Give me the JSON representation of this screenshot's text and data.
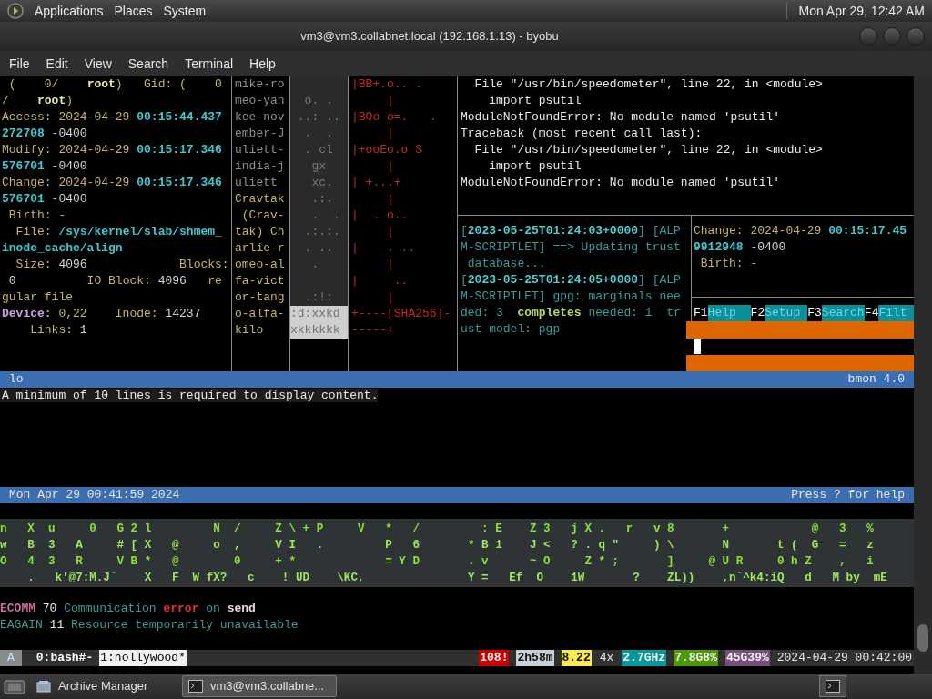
{
  "top_panel": {
    "menus": [
      "Applications",
      "Places",
      "System"
    ],
    "clock": "Mon Apr 29, 12:42 AM"
  },
  "window": {
    "title": "vm3@vm3.collabnet.local (192.168.1.13) - byobu"
  },
  "menu_bar": [
    "File",
    "Edit",
    "View",
    "Search",
    "Terminal",
    "Help"
  ],
  "stat_pane": {
    "lines": [
      [
        {
          "text": " (    0/    ",
          "kind": "label"
        },
        {
          "text": "root",
          "kind": "bold"
        },
        {
          "text": ")   Gid: (    0",
          "kind": "label"
        }
      ],
      [
        {
          "text": "/    ",
          "kind": "label"
        },
        {
          "text": "root",
          "kind": "bold"
        },
        {
          "text": ")",
          "kind": "label"
        }
      ],
      [
        {
          "text": "Access: 2024-04-29 ",
          "kind": "label"
        },
        {
          "text": "00:15:44.437",
          "kind": "time"
        }
      ],
      [
        {
          "text": "272708",
          "kind": "time"
        },
        {
          "text": " -0400",
          "kind": "plain"
        }
      ],
      [
        {
          "text": "Modify: 2024-04-29 ",
          "kind": "label"
        },
        {
          "text": "00:15:17.346",
          "kind": "time"
        }
      ],
      [
        {
          "text": "576701",
          "kind": "time"
        },
        {
          "text": " -0400",
          "kind": "plain"
        }
      ],
      [
        {
          "text": "Change: 2024-04-29 ",
          "kind": "label"
        },
        {
          "text": "00:15:17.346",
          "kind": "time"
        }
      ],
      [
        {
          "text": "576701",
          "kind": "time"
        },
        {
          "text": " -0400",
          "kind": "plain"
        }
      ],
      [
        {
          "text": " Birth: -",
          "kind": "label"
        }
      ],
      [
        {
          "text": "  File: ",
          "kind": "label"
        },
        {
          "text": "/sys/kernel/slab/shmem_",
          "kind": "time"
        }
      ],
      [
        {
          "text": "inode_cache/align",
          "kind": "time"
        }
      ],
      [
        {
          "text": "  Size: ",
          "kind": "label"
        },
        {
          "text": "4096",
          "kind": "plain"
        },
        {
          "text": "             Blocks:",
          "kind": "label"
        }
      ],
      [
        {
          "text": " 0",
          "kind": "plain"
        },
        {
          "text": "          IO Block: ",
          "kind": "label"
        },
        {
          "text": "4096",
          "kind": "plain"
        },
        {
          "text": "   re",
          "kind": "label"
        }
      ],
      [
        {
          "text": "gular file",
          "kind": "label"
        }
      ],
      [
        {
          "text": "Device:",
          "kind": "device"
        },
        {
          "text": " 0,22    Inode: ",
          "kind": "label"
        },
        {
          "text": "14237",
          "kind": "plain"
        }
      ],
      [
        {
          "text": "    Links: ",
          "kind": "label"
        },
        {
          "text": "1",
          "kind": "plain"
        }
      ]
    ]
  },
  "names_pane": {
    "lines": [
      {
        "text": "mike-ro",
        "kind": "dim"
      },
      {
        "text": "meo-yan",
        "kind": "dim"
      },
      {
        "text": "kee-nov",
        "kind": "dim"
      },
      {
        "text": "ember-J",
        "kind": "dim"
      },
      {
        "text": "uliett-",
        "kind": "dim"
      },
      {
        "text": "india-j",
        "kind": "dim"
      },
      {
        "text": "uliett",
        "kind": "dim"
      },
      {
        "text": "Cravtak",
        "kind": "label"
      },
      {
        "text": " (Crav-",
        "kind": "label"
      },
      {
        "text": "tak) Ch",
        "kind": "label"
      },
      {
        "text": "arlie-r",
        "kind": "label"
      },
      {
        "text": "omeo-al",
        "kind": "label"
      },
      {
        "text": "fa-vict",
        "kind": "label"
      },
      {
        "text": "or-tang",
        "kind": "label"
      },
      {
        "text": "o-alfa-",
        "kind": "label"
      },
      {
        "text": "kilo",
        "kind": "label"
      }
    ]
  },
  "blocks_pane": {
    "lines": [
      {
        "kind": "dark"
      },
      {
        "text": "  o. .",
        "kind": "dark"
      },
      {
        "text": " ..: ..",
        "kind": "dark"
      },
      {
        "text": "  .  .",
        "kind": "dark"
      },
      {
        "text": "  . cl",
        "kind": "dark"
      },
      {
        "text": "   gx",
        "kind": "dark"
      },
      {
        "text": "   xc.",
        "kind": "dark"
      },
      {
        "text": "   .:.",
        "kind": "dark"
      },
      {
        "text": "   .  .",
        "kind": "dark"
      },
      {
        "text": "  .:.:.",
        "kind": "dark"
      },
      {
        "text": "  . ..",
        "kind": "dark"
      },
      {
        "text": "   .",
        "kind": "dark"
      },
      {
        "kind": "dark"
      },
      {
        "text": "  .:!:",
        "kind": "dark"
      },
      {
        "text": ":d:xxkd",
        "kind": "light"
      },
      {
        "text": "xkkkkkk",
        "kind": "light"
      }
    ]
  },
  "randomart_pane": {
    "lines": [
      "|BB+.o.. .",
      "     |",
      "|BOo o=.   .",
      "     |",
      "|+ooEo.o S",
      "     |",
      "| +...+",
      "     |",
      "|  . o..",
      "     |",
      "|    . ..",
      "     |",
      "|     ..",
      "     |",
      "+----[SHA256]-",
      "-----+"
    ]
  },
  "traceback_pane": {
    "lines": [
      "  File \"/usr/bin/speedometer\", line 22, in <module>",
      "    import psutil",
      "ModuleNotFoundError: No module named 'psutil'",
      "Traceback (most recent call last):",
      "  File \"/usr/bin/speedometer\", line 22, in <module>",
      "    import psutil",
      "ModuleNotFoundError: No module named 'psutil'"
    ]
  },
  "journal_pane": {
    "lines": [
      [
        {
          "text": "[",
          "kind": "teal"
        },
        {
          "text": "2023-05-25T01:24:03+0000",
          "kind": "stamp"
        },
        {
          "text": "] [ALP",
          "kind": "teal"
        }
      ],
      [
        {
          "text": "M-SCRIPTLET] ==> Updating trust",
          "kind": "teal"
        }
      ],
      [
        {
          "text": " database...",
          "kind": "teal"
        }
      ],
      [
        {
          "text": "[",
          "kind": "teal"
        },
        {
          "text": "2023-05-25T01:24:05+0000",
          "kind": "stamp"
        },
        {
          "text": "] [ALP",
          "kind": "teal"
        }
      ],
      [
        {
          "text": "M-SCRIPTLET] gpg: marginals nee",
          "kind": "teal"
        }
      ],
      [
        {
          "text": "ded: 3  ",
          "kind": "teal"
        },
        {
          "text": "completes",
          "kind": "highlight"
        },
        {
          "text": " needed: 1  tr",
          "kind": "teal"
        }
      ],
      [
        {
          "text": "ust model: pgp",
          "kind": "teal"
        }
      ]
    ]
  },
  "stat_pane_2": {
    "lines": [
      [
        {
          "text": "Change: 2024-04-29 ",
          "kind": "label"
        },
        {
          "text": "00:15:17.45",
          "kind": "time"
        }
      ],
      [
        {
          "text": "9912948",
          "kind": "time"
        },
        {
          "text": " -0400",
          "kind": "plain"
        }
      ],
      [
        {
          "text": " Birth: -",
          "kind": "label"
        }
      ]
    ]
  },
  "function_keys": [
    {
      "key": "F1",
      "label": "Help"
    },
    {
      "key": "F2",
      "label": "Setup"
    },
    {
      "key": "F3",
      "label": "Search"
    },
    {
      "key": "F4",
      "label": "Filt"
    }
  ],
  "bmon": {
    "interface": "lo",
    "version": "bmon 4.0",
    "message": "A minimum of 10 lines is required to display content.",
    "date": "Mon Apr 29 00:41:59 2024",
    "help": "Press ? for help"
  },
  "matrix": {
    "rows": [
      "n   X  u     0   G 2 l         N  /     Z \\ + P     V   *   /         : E    Z 3   j X .   r   v 8       +            @   3   %",
      "w   B  3   A     # [ X   @     o  ,     V I   .         P   6       * B 1    J <   ? . q \"     ) \\       N       t (  G   =   z",
      "O   4  3   R     V B *   @        0     + *             = Y D       . v      ~ O     Z * ;       ]     @ U R     0 h Z    ,   i",
      "    .   k'@7:M.J`    X   F  W fX?   c    ! UD    \\KC,               Y =   Ef  O    1W       ?    ZL))    ,n`^k4:iQ   d   M by  mE"
    ]
  },
  "errors": [
    [
      {
        "text": "ECOMM",
        "kind": "code"
      },
      {
        "text": " 70 ",
        "kind": "white"
      },
      {
        "text": "Communication ",
        "kind": "teal"
      },
      {
        "text": "error",
        "kind": "error"
      },
      {
        "text": " on ",
        "kind": "teal"
      },
      {
        "text": "send",
        "kind": "send"
      }
    ],
    [
      {
        "text": "EAGAIN",
        "kind": "teal"
      },
      {
        "text": " 11 ",
        "kind": "white"
      },
      {
        "text": "Resource temporarily unavailable",
        "kind": "teal"
      }
    ]
  ],
  "status_bar": {
    "session": "A",
    "windows": [
      {
        "label": "0:bash#-",
        "selected": false
      },
      {
        "label": "1:hollywood*",
        "selected": true
      }
    ],
    "indicators": [
      {
        "text": "108!",
        "color": "#cc0000"
      },
      {
        "text": "2h58m",
        "color": "#c8d0d8"
      },
      {
        "text": "8.22",
        "color": "#fce94f"
      },
      {
        "text": "4x"
      },
      {
        "text": "2.7GHz",
        "color": "#06989a"
      },
      {
        "text": "7.8G8%",
        "color": "#4e9a06"
      },
      {
        "text": "45G39%",
        "color": "#75507b"
      }
    ],
    "datetime": "2024-04-29 00:42:00"
  },
  "taskbar": {
    "items": [
      {
        "label": "Archive Manager",
        "selected": false
      },
      {
        "label": "vm3@vm3.collabne...",
        "selected": true
      }
    ]
  }
}
